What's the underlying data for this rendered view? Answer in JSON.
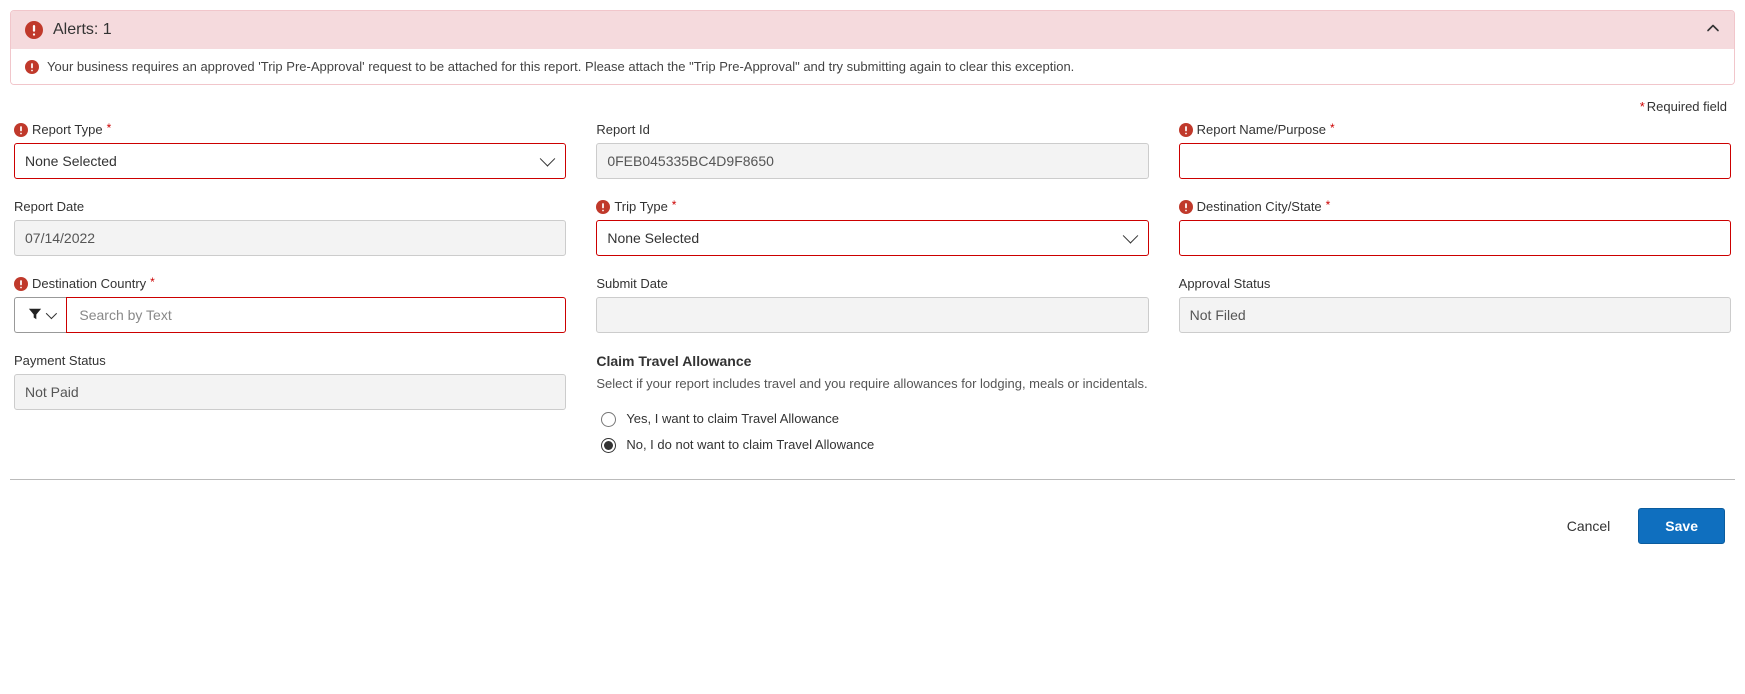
{
  "alert": {
    "title": "Alerts: 1",
    "message": "Your business requires an approved 'Trip Pre-Approval' request to be attached for this report. Please attach the \"Trip Pre-Approval\" and try submitting again to clear this exception."
  },
  "required_note": "Required field",
  "fields": {
    "report_type": {
      "label": "Report Type",
      "value": "None Selected"
    },
    "report_id": {
      "label": "Report Id",
      "value": "0FEB045335BC4D9F8650"
    },
    "report_name": {
      "label": "Report Name/Purpose",
      "value": ""
    },
    "report_date": {
      "label": "Report Date",
      "value": "07/14/2022"
    },
    "trip_type": {
      "label": "Trip Type",
      "value": "None Selected"
    },
    "dest_city": {
      "label": "Destination City/State",
      "value": ""
    },
    "dest_country": {
      "label": "Destination Country",
      "placeholder": "Search by Text",
      "value": ""
    },
    "submit_date": {
      "label": "Submit Date",
      "value": ""
    },
    "approval_status": {
      "label": "Approval Status",
      "value": "Not Filed"
    },
    "payment_status": {
      "label": "Payment Status",
      "value": "Not Paid"
    }
  },
  "claim": {
    "title": "Claim Travel Allowance",
    "desc": "Select if your report includes travel and you require allowances for lodging, meals or incidentals.",
    "yes": "Yes, I want to claim Travel Allowance",
    "no": "No, I do not want to claim Travel Allowance",
    "selected": "no"
  },
  "buttons": {
    "cancel": "Cancel",
    "save": "Save"
  }
}
